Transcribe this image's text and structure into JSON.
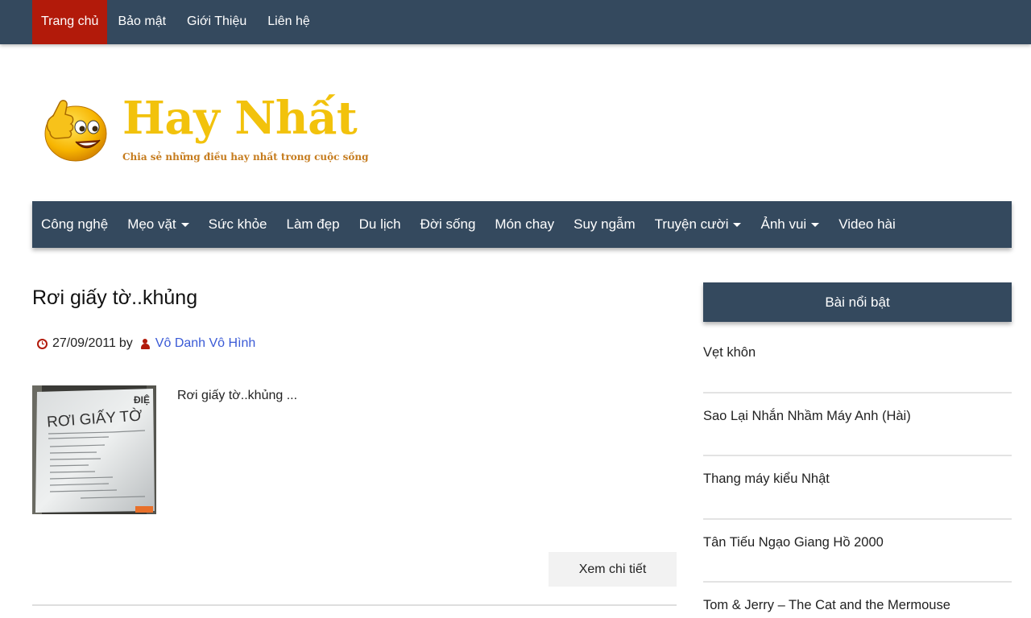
{
  "topnav": {
    "items": [
      {
        "label": "Trang chủ",
        "active": true
      },
      {
        "label": "Bảo mật",
        "active": false
      },
      {
        "label": "Giới Thiệu",
        "active": false
      },
      {
        "label": "Liên hệ",
        "active": false
      }
    ]
  },
  "logo": {
    "title": "Hay Nhất",
    "tagline": "Chia sẻ những điều hay nhất trong cuộc sống",
    "icon": "thumbs-up-smiley-icon"
  },
  "mainnav": {
    "items": [
      {
        "label": "Công nghệ",
        "dropdown": false
      },
      {
        "label": "Mẹo vặt",
        "dropdown": true
      },
      {
        "label": "Sức khỏe",
        "dropdown": false
      },
      {
        "label": "Làm đẹp",
        "dropdown": false
      },
      {
        "label": "Du lịch",
        "dropdown": false
      },
      {
        "label": "Đời sống",
        "dropdown": false
      },
      {
        "label": "Món chay",
        "dropdown": false
      },
      {
        "label": "Suy ngẫm",
        "dropdown": false
      },
      {
        "label": "Truyện cười",
        "dropdown": true
      },
      {
        "label": "Ảnh vui",
        "dropdown": true
      },
      {
        "label": "Video hài",
        "dropdown": false
      }
    ]
  },
  "post": {
    "title": "Rơi giấy tờ..khủng",
    "date": "27/09/2011",
    "by": "by",
    "author": "Vô Danh Vô Hình",
    "excerpt": "Rơi giấy tờ..khủng ...",
    "read_more": "Xem chi tiết",
    "thumbnail": {
      "heading": "RƠI GIẤY TỜ",
      "corner": "ĐIỆ"
    }
  },
  "sidebar": {
    "title": "Bài nổi bật",
    "items": [
      "Vẹt khôn",
      "Sao Lại Nhắn Nhầm Máy Anh (Hài)",
      "Thang máy kiểu Nhật",
      "Tân Tiếu Ngạo Giang Hồ 2000",
      "Tom & Jerry – The Cat and the Mermouse"
    ]
  },
  "colors": {
    "nav_bg": "#34495e",
    "active": "#b21a0a",
    "logo_gold": "#f2c20c",
    "link": "#3a5ad6"
  }
}
